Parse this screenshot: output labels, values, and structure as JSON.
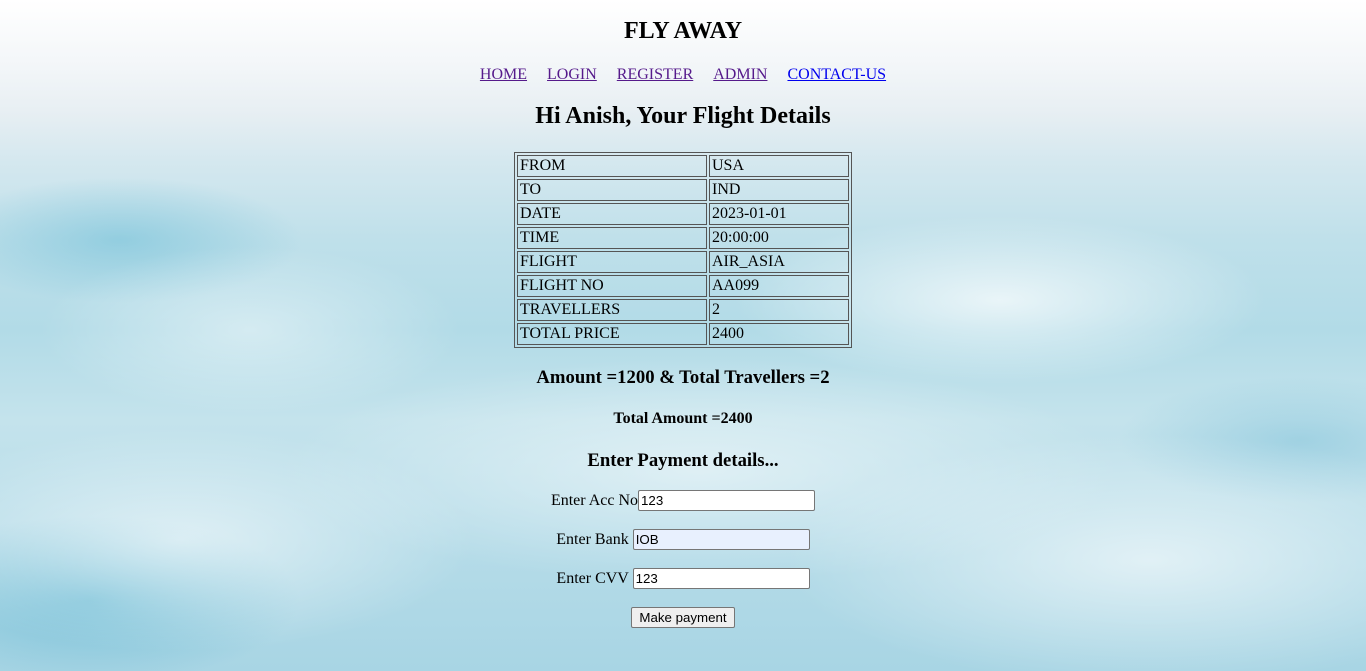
{
  "site": {
    "title": "FLY AWAY"
  },
  "nav": {
    "items": [
      {
        "label": "HOME"
      },
      {
        "label": "LOGIN"
      },
      {
        "label": "REGISTER"
      },
      {
        "label": "ADMIN"
      },
      {
        "label": "CONTACT-US"
      }
    ]
  },
  "greeting": "Hi Anish, Your Flight Details",
  "flight_details": [
    {
      "label": "FROM",
      "value": "USA"
    },
    {
      "label": "TO",
      "value": "IND"
    },
    {
      "label": "DATE",
      "value": "2023-01-01"
    },
    {
      "label": "TIME",
      "value": "20:00:00"
    },
    {
      "label": "FLIGHT",
      "value": "AIR_ASIA"
    },
    {
      "label": "FLIGHT NO",
      "value": "AA099"
    },
    {
      "label": "TRAVELLERS",
      "value": "2"
    },
    {
      "label": "TOTAL PRICE",
      "value": "2400"
    }
  ],
  "summary": {
    "amount_line": "Amount =1200 & Total Travellers =2",
    "total_line": "Total Amount =2400"
  },
  "payment": {
    "heading": "Enter Payment details...",
    "acc_label": "Enter Acc No",
    "acc_value": "123",
    "bank_label": "Enter Bank",
    "bank_value": "IOB",
    "cvv_label": "Enter CVV",
    "cvv_value": "123",
    "submit_label": "Make payment"
  },
  "colors": {
    "visited_link": "#551a8b",
    "unvisited_link": "#0000ee",
    "autofill_bg": "#e8f0fe"
  }
}
